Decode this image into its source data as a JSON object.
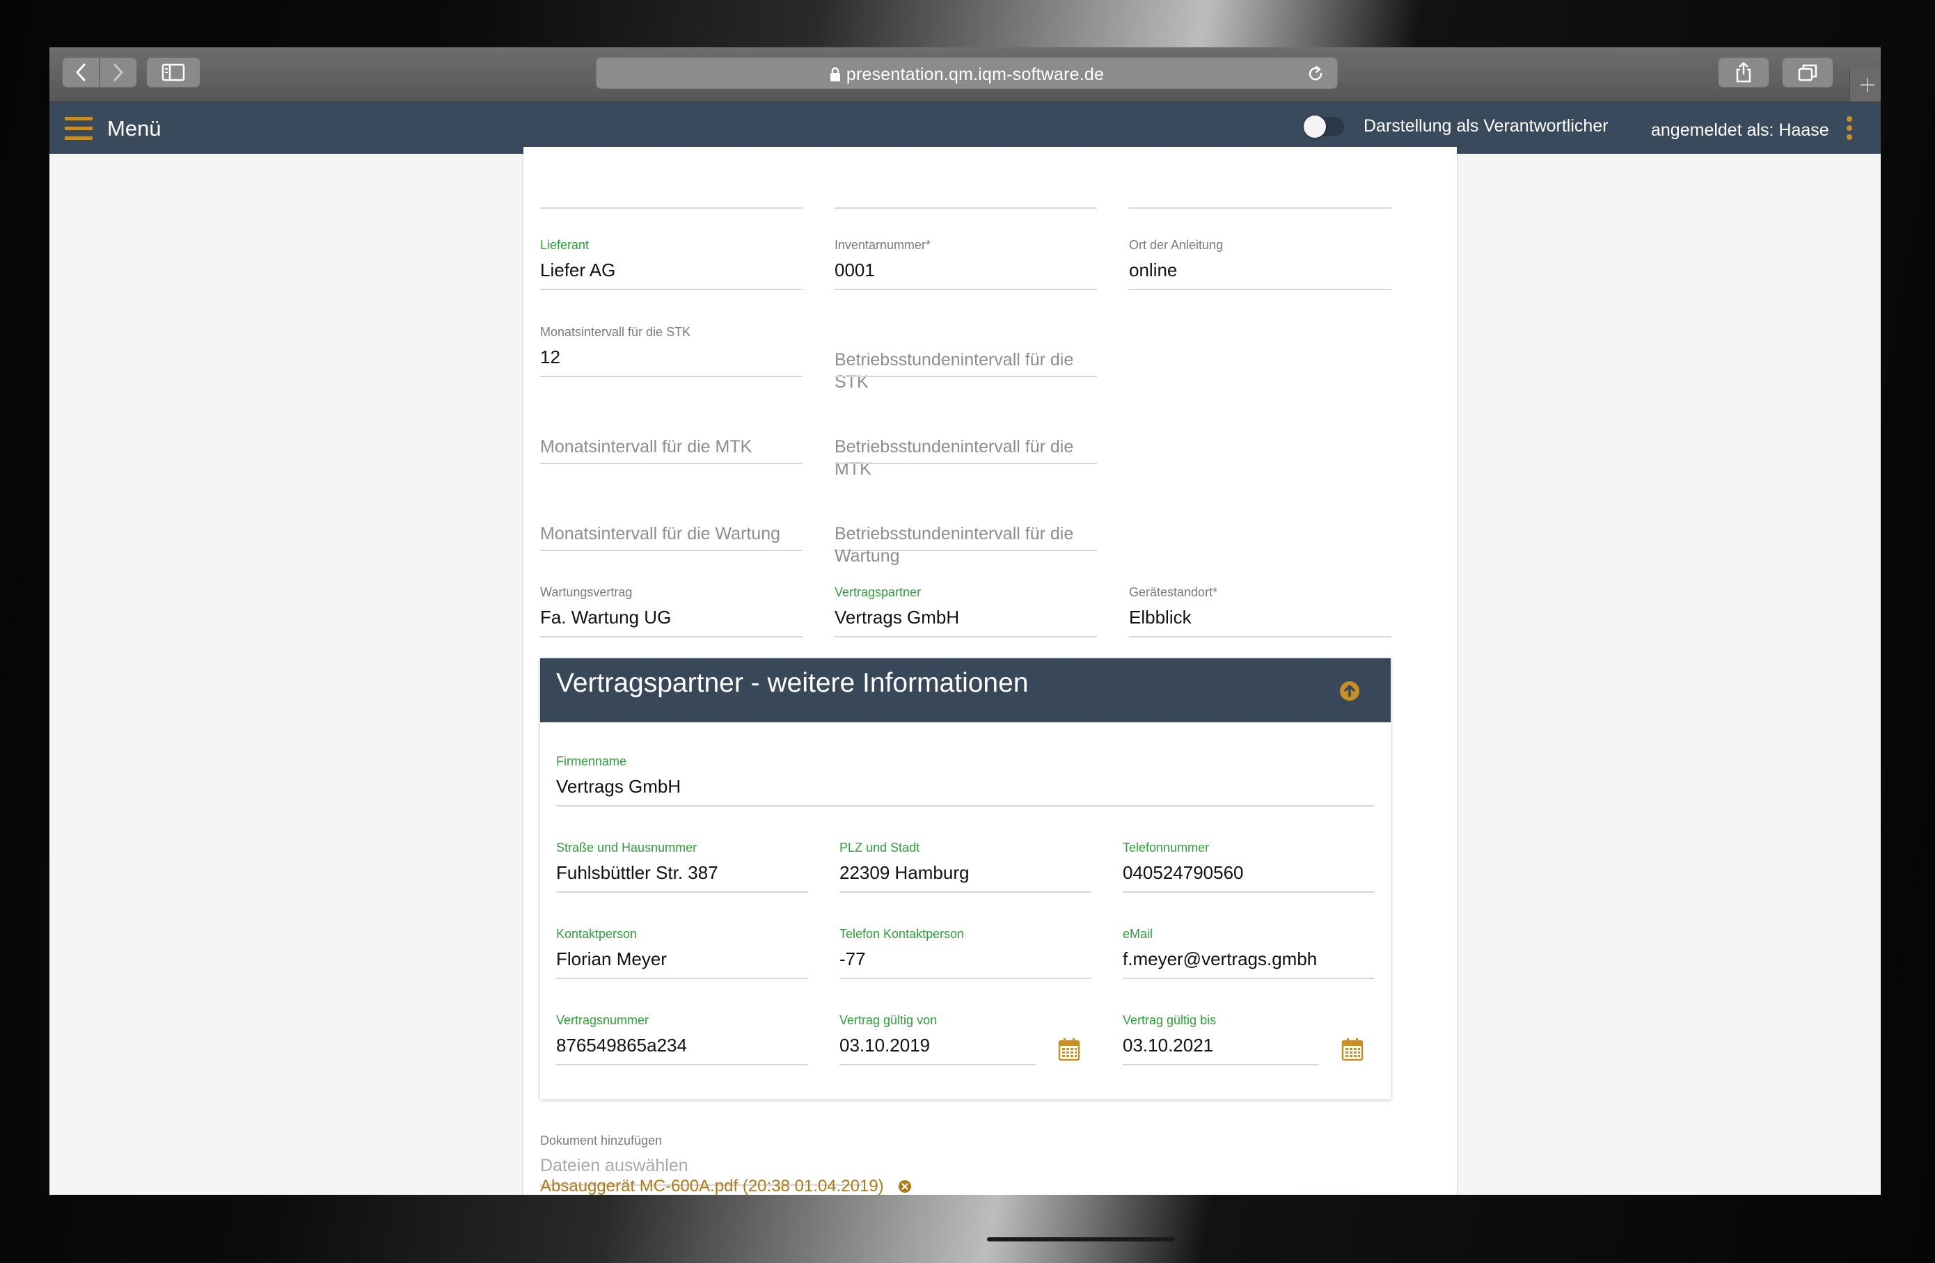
{
  "browser": {
    "url": "presentation.qm.iqm-software.de"
  },
  "header": {
    "menu_label": "Menü",
    "toggle_label": "Darstellung als Verantwortlicher",
    "login_label": "angemeldet als: Haase"
  },
  "form": {
    "lieferant": {
      "label": "Lieferant",
      "value": "Liefer AG"
    },
    "inventarnummer": {
      "label": "Inventarnummer*",
      "value": "0001"
    },
    "ort_anleitung": {
      "label": "Ort der Anleitung",
      "value": "online"
    },
    "monat_stk": {
      "label": "Monatsintervall für die STK",
      "value": "12"
    },
    "betrieb_stk": {
      "placeholder": "Betriebsstundenintervall für die STK"
    },
    "monat_mtk": {
      "placeholder": "Monatsintervall für die MTK"
    },
    "betrieb_mtk": {
      "placeholder": "Betriebsstundenintervall für die MTK"
    },
    "monat_wartung": {
      "placeholder": "Monatsintervall für die Wartung"
    },
    "betrieb_wartung": {
      "placeholder_line1": "Betriebsstundenintervall für die",
      "placeholder_line2": "Wartung"
    },
    "wartungsvertrag": {
      "label": "Wartungsvertrag",
      "value": "Fa. Wartung UG"
    },
    "vertragspartner": {
      "label": "Vertragspartner",
      "value": "Vertrags GmbH"
    },
    "geraetestandort": {
      "label": "Gerätestandort*",
      "value": "Elbblick"
    }
  },
  "vertragspartner_panel": {
    "title": "Vertragspartner - weitere Informationen",
    "firmenname": {
      "label": "Firmenname",
      "value": "Vertrags GmbH"
    },
    "strasse": {
      "label": "Straße und Hausnummer",
      "value": "Fuhlsbüttler Str. 387"
    },
    "plz_stadt": {
      "label": "PLZ und Stadt",
      "value": "22309 Hamburg"
    },
    "telefon": {
      "label": "Telefonnummer",
      "value": "040524790560"
    },
    "kontaktperson": {
      "label": "Kontaktperson",
      "value": "Florian Meyer"
    },
    "telefon_kontakt": {
      "label": "Telefon Kontaktperson",
      "value": "-77"
    },
    "email": {
      "label": "eMail",
      "value": "f.meyer@vertrags.gmbh"
    },
    "vertragsnummer": {
      "label": "Vertragsnummer",
      "value": "876549865a234"
    },
    "gueltig_von": {
      "label": "Vertrag gültig von",
      "value": "03.10.2019"
    },
    "gueltig_bis": {
      "label": "Vertrag gültig bis",
      "value": "03.10.2021"
    }
  },
  "documents": {
    "label": "Dokument hinzufügen",
    "placeholder": "Dateien auswählen",
    "attached": "Absauggerät MC-600A.pdf (20:38 01.04.2019)"
  },
  "colors": {
    "header_bg": "#3a4a5d",
    "accent": "#c98f27",
    "label_green": "#2fa039"
  }
}
